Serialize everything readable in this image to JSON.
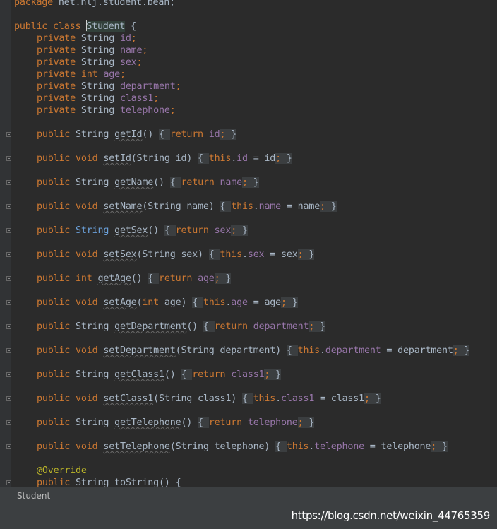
{
  "editor": {
    "package_line": {
      "kw": "package",
      "rest": " net.hlj.student.bean;"
    },
    "class_decl": {
      "mod": "public class ",
      "name": "Student",
      "rest": " {"
    },
    "fields": [
      {
        "mods": "private ",
        "type": "String ",
        "name": "id",
        "semi": ";"
      },
      {
        "mods": "private ",
        "type": "String ",
        "name": "name",
        "semi": ";"
      },
      {
        "mods": "private ",
        "type": "String ",
        "name": "sex",
        "semi": ";"
      },
      {
        "mods": "private ",
        "type": "int",
        "name": "age",
        "semi": ";"
      },
      {
        "mods": "private ",
        "type": "String ",
        "name": "department",
        "semi": ";"
      },
      {
        "mods": "private ",
        "type": "String ",
        "name": "class1",
        "semi": ";"
      },
      {
        "mods": "private ",
        "type": "String ",
        "name": "telephone",
        "semi": ";"
      }
    ],
    "methods": [
      {
        "mod": "public ",
        "type": "String",
        "name": "getId",
        "params_pre": "()",
        "params_kw": "",
        "params_post": "",
        "ret_kw": "return ",
        "this_kw": "",
        "this_dot": "",
        "field": "id",
        "assign": ""
      },
      {
        "mod": "public ",
        "type": "void",
        "name": "setId",
        "params_pre": "(String id)",
        "params_kw": "",
        "params_post": "",
        "ret_kw": "",
        "this_kw": "this",
        "this_dot": ".",
        "field": "id",
        "assign": " = id"
      },
      {
        "mod": "public ",
        "type": "String",
        "name": "getName",
        "params_pre": "()",
        "params_kw": "",
        "params_post": "",
        "ret_kw": "return ",
        "this_kw": "",
        "this_dot": "",
        "field": "name",
        "assign": ""
      },
      {
        "mod": "public ",
        "type": "void",
        "name": "setName",
        "params_pre": "(String name)",
        "params_kw": "",
        "params_post": "",
        "ret_kw": "",
        "this_kw": "this",
        "this_dot": ".",
        "field": "name",
        "assign": " = name"
      },
      {
        "mod": "public ",
        "type": "String",
        "name": "getSex",
        "params_pre": "()",
        "params_kw": "",
        "params_post": "",
        "ret_kw": "return ",
        "this_kw": "",
        "this_dot": "",
        "field": "sex",
        "assign": "",
        "type_link": true
      },
      {
        "mod": "public ",
        "type": "void",
        "name": "setSex",
        "params_pre": "(String sex)",
        "params_kw": "",
        "params_post": "",
        "ret_kw": "",
        "this_kw": "this",
        "this_dot": ".",
        "field": "sex",
        "assign": " = sex"
      },
      {
        "mod": "public ",
        "type": "int",
        "name": "getAge",
        "params_pre": "()",
        "params_kw": "",
        "params_post": "",
        "ret_kw": "return ",
        "this_kw": "",
        "this_dot": "",
        "field": "age",
        "assign": "",
        "type_kw": true
      },
      {
        "mod": "public ",
        "type": "void",
        "name": "setAge",
        "params_pre": "(",
        "params_kw": "int",
        "params_post": " age)",
        "ret_kw": "",
        "this_kw": "this",
        "this_dot": ".",
        "field": "age",
        "assign": " = age"
      },
      {
        "mod": "public ",
        "type": "String",
        "name": "getDepartment",
        "params_pre": "()",
        "params_kw": "",
        "params_post": "",
        "ret_kw": "return ",
        "this_kw": "",
        "this_dot": "",
        "field": "department",
        "assign": ""
      },
      {
        "mod": "public ",
        "type": "void",
        "name": "setDepartment",
        "params_pre": "(String department)",
        "params_kw": "",
        "params_post": "",
        "ret_kw": "",
        "this_kw": "this",
        "this_dot": ".",
        "field": "department",
        "assign": " = department"
      },
      {
        "mod": "public ",
        "type": "String",
        "name": "getClass1",
        "params_pre": "()",
        "params_kw": "",
        "params_post": "",
        "ret_kw": "return ",
        "this_kw": "",
        "this_dot": "",
        "field": "class1",
        "assign": ""
      },
      {
        "mod": "public ",
        "type": "void",
        "name": "setClass1",
        "params_pre": "(String class1)",
        "params_kw": "",
        "params_post": "",
        "ret_kw": "",
        "this_kw": "this",
        "this_dot": ".",
        "field": "class1",
        "assign": " = class1"
      },
      {
        "mod": "public ",
        "type": "String",
        "name": "getTelephone",
        "params_pre": "()",
        "params_kw": "",
        "params_post": "",
        "ret_kw": "return ",
        "this_kw": "",
        "this_dot": "",
        "field": "telephone",
        "assign": ""
      },
      {
        "mod": "public ",
        "type": "void",
        "name": "setTelephone",
        "params_pre": "(String telephone)",
        "params_kw": "",
        "params_post": "",
        "ret_kw": "",
        "this_kw": "this",
        "this_dot": ".",
        "field": "telephone",
        "assign": " = telephone"
      }
    ],
    "annotation": "@Override",
    "tostring_line": {
      "mod": "public ",
      "type": "String ",
      "name": "toString",
      "rest": "() {"
    }
  },
  "status_bar": {
    "breadcrumb": "Student"
  },
  "watermark": "https://blog.csdn.net/weixin_44765359",
  "colors": {
    "background": "#2B2B2B",
    "keyword": "#CC7832",
    "field": "#9876AA",
    "text": "#A9B7C6",
    "annotation": "#BBB529"
  }
}
